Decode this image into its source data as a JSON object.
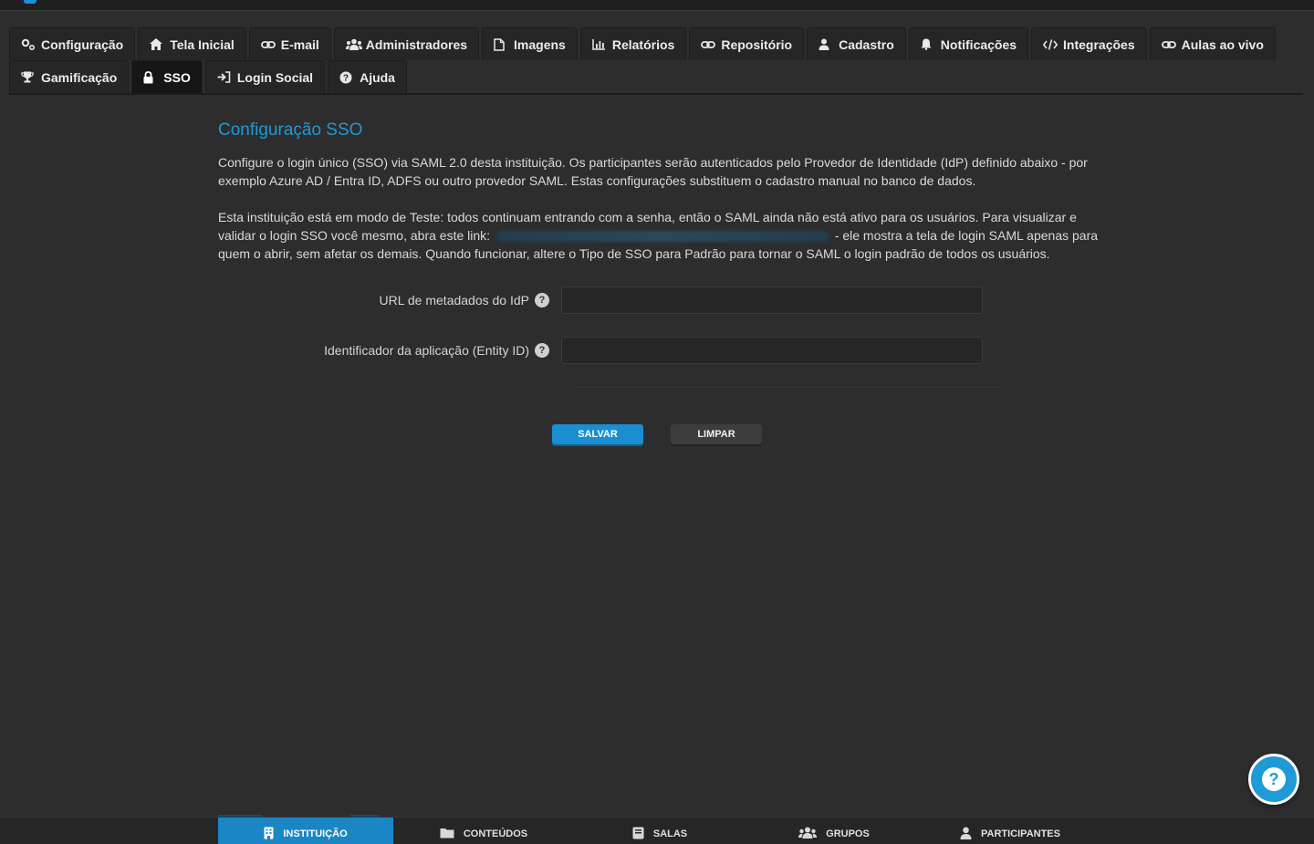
{
  "tabs": {
    "row1": [
      {
        "label": "Configuração",
        "icon": "gears-icon"
      },
      {
        "label": "Tela Inicial",
        "icon": "home-icon"
      },
      {
        "label": "E-mail",
        "icon": "link-icon"
      },
      {
        "label": "Administradores",
        "icon": "users-icon"
      },
      {
        "label": "Imagens",
        "icon": "file-icon"
      },
      {
        "label": "Relatórios",
        "icon": "bar-chart-icon"
      },
      {
        "label": "Repositório",
        "icon": "link-icon"
      },
      {
        "label": "Cadastro",
        "icon": "user-icon"
      },
      {
        "label": "Notificações",
        "icon": "bell-icon"
      },
      {
        "label": "Integrações",
        "icon": "code-icon"
      },
      {
        "label": "Aulas ao vivo",
        "icon": "link-icon"
      }
    ],
    "row2": [
      {
        "label": "Gamificação",
        "icon": "trophy-icon"
      },
      {
        "label": "SSO",
        "icon": "lock-icon",
        "active": true
      },
      {
        "label": "Login Social",
        "icon": "sign-in-icon"
      },
      {
        "label": "Ajuda",
        "icon": "question-circle-icon"
      }
    ]
  },
  "sso": {
    "title": "Configuração SSO",
    "intro": "Configure o login único (SSO) via SAML 2.0 desta instituição. Os participantes serão autenticados pelo Provedor de Identidade (IdP) definido abaixo - por exemplo Azure AD / Entra ID, ADFS ou outro provedor SAML. Estas configurações substituem o cadastro manual no banco de dados.",
    "test_mode_before": "Esta instituição está em modo de Teste: todos continuam entrando com a senha, então o SAML ainda não está ativo para os usuários. Para visualizar e validar o login SSO você mesmo, abra este link:",
    "test_mode_after": "- ele mostra a tela de login SAML apenas para quem o abrir, sem afetar os demais. Quando funcionar, altere o Tipo de SSO para Padrão para tornar o SAML o login padrão de todos os usuários.",
    "fields": {
      "metadata_url": {
        "label": "URL de metadados do IdP",
        "value": ""
      },
      "entity_id": {
        "label": "Identificador da aplicação (Entity ID)",
        "value": ""
      }
    },
    "buttons": {
      "save": "SALVAR",
      "clear": "LIMPAR"
    }
  },
  "help_fab": {
    "glyph": "?"
  },
  "bottom_nav": [
    {
      "label": "INSTITUIÇÃO",
      "icon": "building-icon",
      "active": true
    },
    {
      "label": "CONTEÚDOS",
      "icon": "folder-icon"
    },
    {
      "label": "SALAS",
      "icon": "book-icon"
    },
    {
      "label": "GRUPOS",
      "icon": "users-icon"
    },
    {
      "label": "PARTICIPANTES",
      "icon": "user-icon"
    }
  ],
  "colors": {
    "accent": "#1e9ad6",
    "background": "#2d2d2e",
    "tab_bg": "#262627",
    "tab_active_bg": "#161617",
    "save_button": "#1a8ed0"
  }
}
